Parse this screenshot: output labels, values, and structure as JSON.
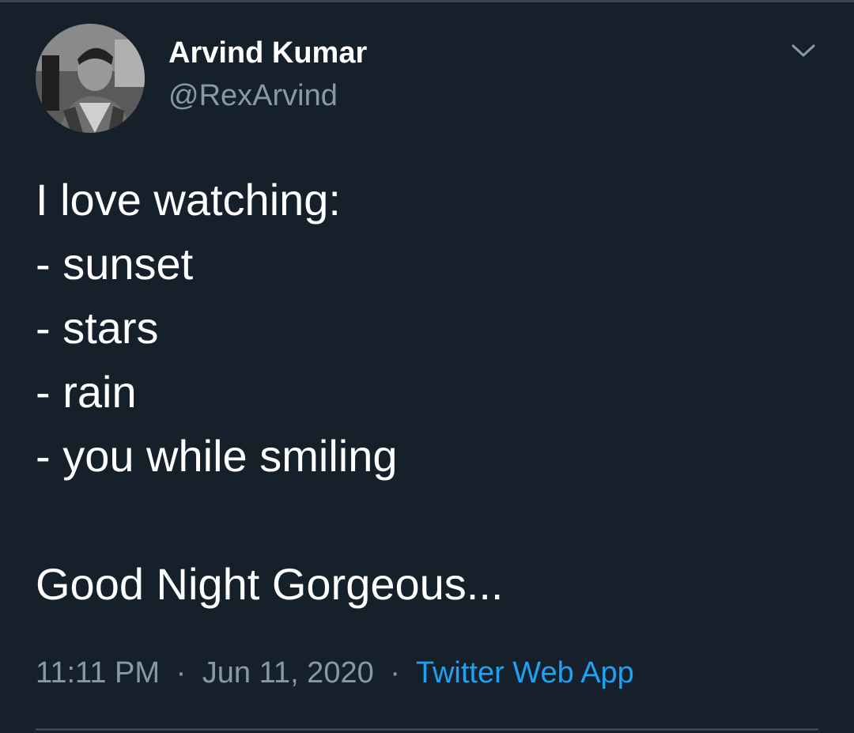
{
  "tweet": {
    "author": {
      "name": "Arvind Kumar",
      "handle": "@RexArvind"
    },
    "menu_icon": "chevron-down-icon",
    "body_lines": [
      "I love watching:",
      "- sunset",
      "- stars",
      "- rain",
      "- you while smiling",
      "",
      "Good Night Gorgeous..."
    ],
    "meta": {
      "time": "11:11 PM",
      "separator": "·",
      "date": "Jun 11, 2020",
      "source": "Twitter Web App"
    }
  },
  "colors": {
    "background": "#15202b",
    "primary_text": "#ffffff",
    "secondary_text": "#8899a6",
    "link": "#1da1f2",
    "divider": "#38444d"
  }
}
